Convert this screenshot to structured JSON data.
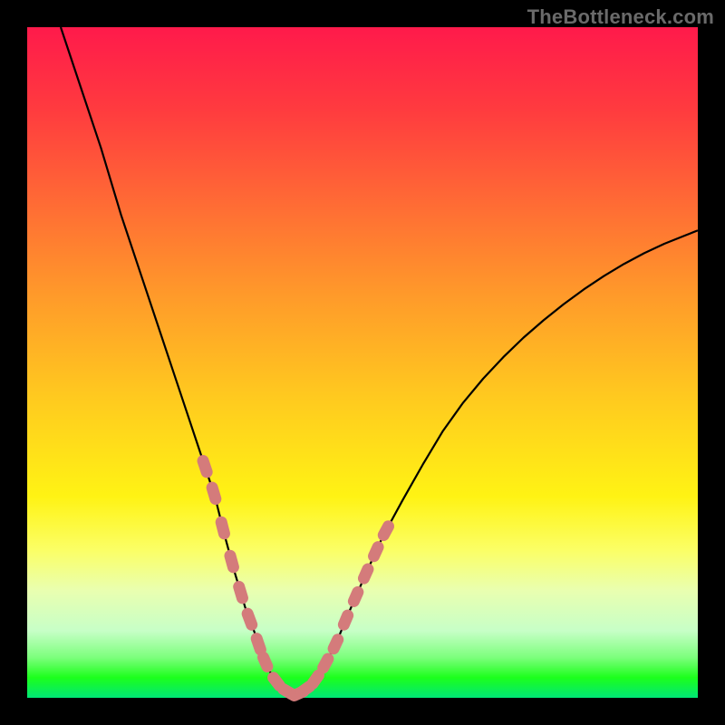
{
  "watermark": "TheBottleneck.com",
  "colors": {
    "frame": "#000000",
    "marker": "#d47b7b",
    "line": "#000000",
    "gradient_stops": [
      "#ff1a4b",
      "#ff3a3f",
      "#ff6a35",
      "#ff9a2a",
      "#ffc91f",
      "#fff314",
      "#fbff66",
      "#e9ffb0",
      "#c7ffc7",
      "#7cff7c",
      "#1cff1c",
      "#00e676"
    ]
  },
  "chart_data": {
    "type": "line",
    "title": "",
    "xlabel": "",
    "ylabel": "",
    "xlim": [
      0,
      100
    ],
    "ylim": [
      0,
      100
    ],
    "x": [
      5,
      8,
      11,
      14,
      17,
      20,
      22,
      24,
      26,
      28,
      29.5,
      31,
      32.5,
      34,
      35,
      36,
      37,
      38,
      39,
      40,
      41,
      42.5,
      44,
      46,
      48,
      50.5,
      53,
      56,
      59,
      62,
      65,
      68,
      71,
      74,
      77,
      80,
      83,
      86,
      89,
      92,
      95,
      98,
      100
    ],
    "y": [
      100,
      91,
      82,
      72,
      63,
      54,
      48,
      42,
      36,
      30,
      24,
      18.5,
      13.5,
      9.5,
      6.5,
      4.2,
      2.6,
      1.5,
      0.8,
      0.4,
      0.9,
      2.0,
      4.2,
      8.0,
      12.8,
      18.5,
      24.0,
      29.5,
      34.8,
      39.8,
      44.0,
      47.6,
      50.8,
      53.7,
      56.3,
      58.7,
      60.9,
      62.9,
      64.7,
      66.3,
      67.7,
      68.9,
      69.7
    ],
    "markers": {
      "left": {
        "x_range": [
          26.5,
          34.5
        ],
        "y_range": [
          7,
          32
        ],
        "count": 7
      },
      "right": {
        "x_range": [
          41.5,
          53.5
        ],
        "y_range": [
          1,
          25
        ],
        "count": 9
      },
      "bottom": {
        "x_range": [
          35.5,
          40.5
        ],
        "y_range": [
          0.4,
          5.5
        ],
        "count": 4
      }
    }
  }
}
